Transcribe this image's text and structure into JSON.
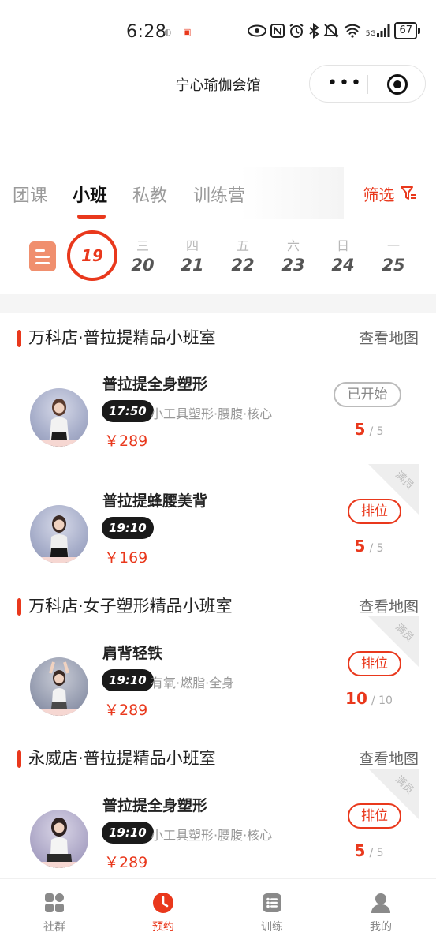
{
  "status_bar": {
    "time": "6:28",
    "indicators": [
      "eye-icon",
      "nfc-icon",
      "alarm-icon",
      "bluetooth-icon",
      "mute-icon",
      "wifi-icon",
      "5g-signal-icon"
    ],
    "network": "5G",
    "battery": "67"
  },
  "header": {
    "title": "宁心瑜伽会馆"
  },
  "category_tabs": {
    "items": [
      {
        "label": "团课"
      },
      {
        "label": "小班"
      },
      {
        "label": "私教"
      },
      {
        "label": "训练营"
      }
    ],
    "selected": "小班",
    "filter_label": "筛选"
  },
  "dates": {
    "today": "19",
    "days": [
      {
        "weekday": "三",
        "day": "20"
      },
      {
        "weekday": "四",
        "day": "21"
      },
      {
        "weekday": "五",
        "day": "22"
      },
      {
        "weekday": "六",
        "day": "23"
      },
      {
        "weekday": "日",
        "day": "24"
      },
      {
        "weekday": "一",
        "day": "25"
      }
    ]
  },
  "studios": [
    {
      "name": "万科店·普拉提精品小班室",
      "map_label": "查看地图",
      "classes": [
        {
          "name": "普拉提全身塑形",
          "time": "17:50",
          "tags": "小工具塑形·腰腹·核心",
          "price": "￥289",
          "status": "已开始",
          "booked": "5",
          "capacity": "/ 5",
          "full": false
        },
        {
          "name": "普拉提蜂腰美背",
          "time": "19:10",
          "tags": "",
          "price": "￥169",
          "status": "排位",
          "booked": "5",
          "capacity": "/ 5",
          "full": true,
          "full_label": "满员"
        }
      ]
    },
    {
      "name": "万科店·女子塑形精品小班室",
      "map_label": "查看地图",
      "classes": [
        {
          "name": "肩背轻铁",
          "time": "19:10",
          "tags": "有氧·燃脂·全身",
          "price": "￥289",
          "status": "排位",
          "booked": "10",
          "capacity": "/ 10",
          "full": true,
          "full_label": "满员"
        }
      ]
    },
    {
      "name": "永威店·普拉提精品小班室",
      "map_label": "查看地图",
      "classes": [
        {
          "name": "普拉提全身塑形",
          "time": "19:10",
          "tags": "小工具塑形·腰腹·核心",
          "price": "￥289",
          "status": "排位",
          "booked": "5",
          "capacity": "/ 5",
          "full": true,
          "full_label": "满员"
        }
      ]
    }
  ],
  "tab_bar": {
    "items": [
      {
        "label": "社群",
        "icon": "community-icon"
      },
      {
        "label": "预约",
        "icon": "booking-clock-icon"
      },
      {
        "label": "训练",
        "icon": "training-list-icon"
      },
      {
        "label": "我的",
        "icon": "profile-icon"
      }
    ],
    "active": "预约"
  },
  "colors": {
    "accent": "#e9381c",
    "calendar_button": "#f08f6e",
    "time_pill": "#1a1a1a"
  }
}
